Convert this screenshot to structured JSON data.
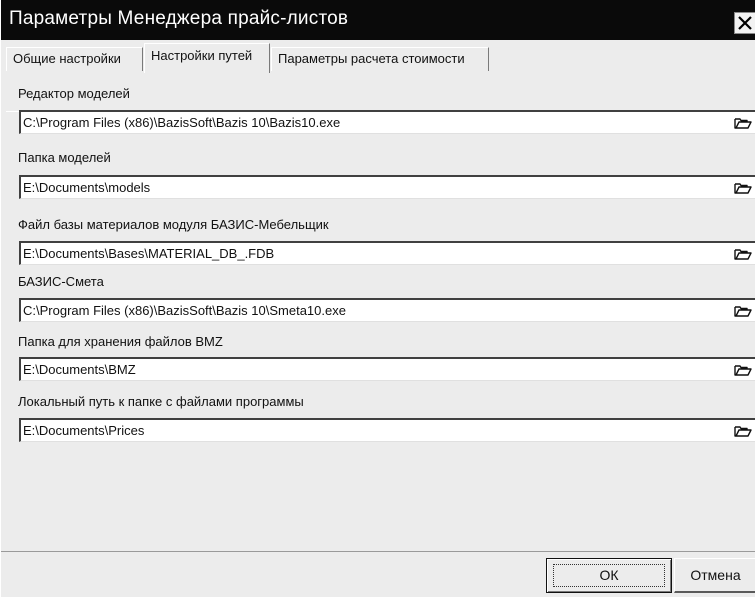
{
  "window": {
    "title": "Параметры Менеджера прайс-листов"
  },
  "tabs": [
    {
      "label": "Общие настройки",
      "active": false
    },
    {
      "label": "Настройки путей",
      "active": true
    },
    {
      "label": "Параметры расчета стоимости",
      "active": false
    }
  ],
  "fields": [
    {
      "label": "Редактор моделей",
      "value": "C:\\Program Files (x86)\\BazisSoft\\Bazis 10\\Bazis10.exe"
    },
    {
      "label": "Папка моделей",
      "value": "E:\\Documents\\models"
    },
    {
      "label": "Файл базы материалов модуля БАЗИС-Мебельщик",
      "value": "E:\\Documents\\Bases\\MATERIAL_DB_.FDB"
    },
    {
      "label": "БАЗИС-Смета",
      "value": "C:\\Program Files (x86)\\BazisSoft\\Bazis 10\\Smeta10.exe"
    },
    {
      "label": "Папка для хранения файлов BMZ",
      "value": "E:\\Documents\\BMZ"
    },
    {
      "label": "Локальный путь к папке с файлами программы",
      "value": "E:\\Documents\\Prices"
    }
  ],
  "buttons": {
    "ok_label": "ОК",
    "cancel_label": "Отмена"
  },
  "icons": {
    "close": "close-icon",
    "browse": "folder-open-icon"
  },
  "colors": {
    "titlebar": "#0a0a0a",
    "title_text": "#ffffff",
    "window_bg": "#ececec"
  }
}
